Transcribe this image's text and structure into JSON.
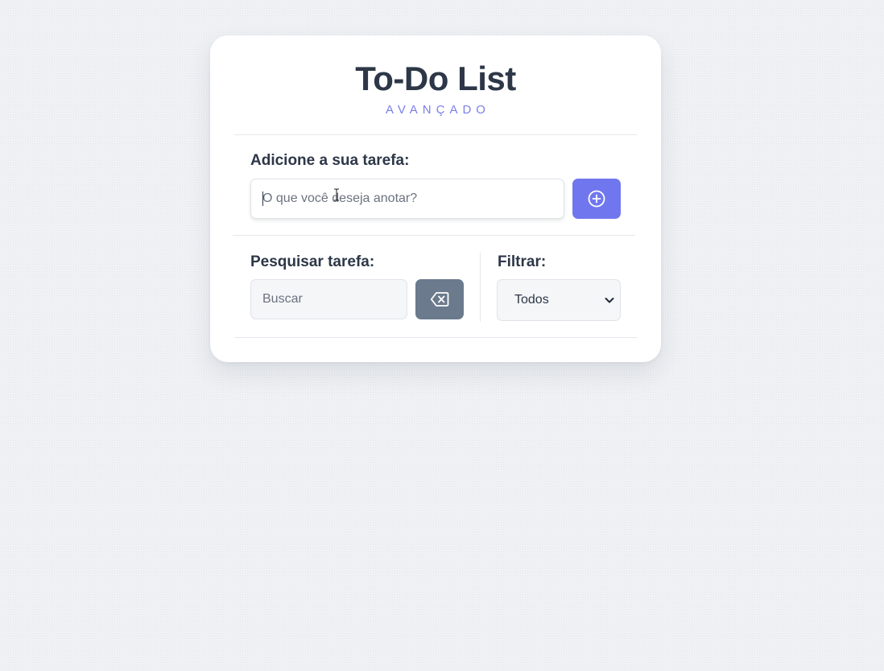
{
  "app": {
    "title": "To-Do List",
    "subtitle": "AVANÇADO"
  },
  "add_task": {
    "label": "Adicione a sua tarefa:",
    "placeholder": "O que você deseja anotar?",
    "value": "",
    "button_icon": "plus-circle-icon"
  },
  "search": {
    "label": "Pesquisar tarefa:",
    "placeholder": "Buscar",
    "value": "",
    "clear_button_icon": "backspace-icon"
  },
  "filter": {
    "label": "Filtrar:",
    "selected": "Todos",
    "icon": "chevron-down-icon"
  },
  "colors": {
    "accent": "#7077ee",
    "subtitle": "#7b7fe8",
    "clear_button": "#6b7a8c",
    "text": "#2d3748"
  }
}
